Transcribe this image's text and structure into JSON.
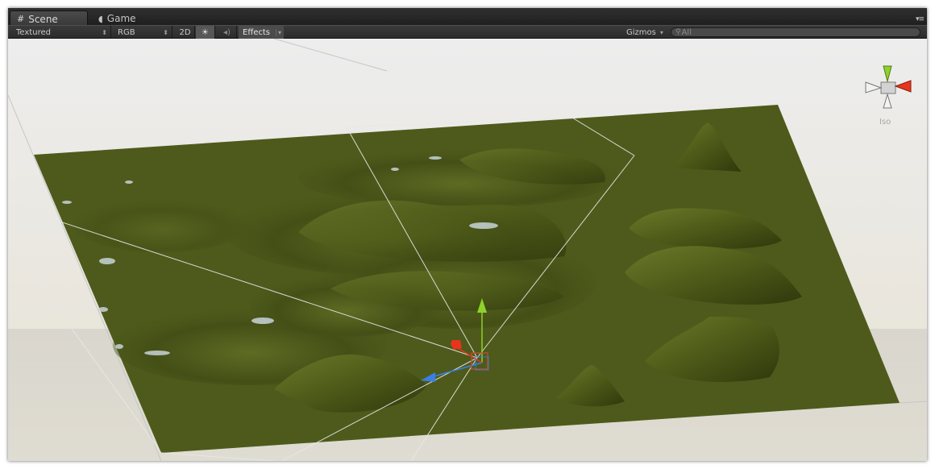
{
  "tabs": [
    {
      "label": "Scene",
      "icon": "grid-icon",
      "active": true
    },
    {
      "label": "Game",
      "icon": "pacman-icon",
      "active": false
    }
  ],
  "toolbar": {
    "render_mode": "Textured",
    "color_mode": "RGB",
    "mode_2d": "2D",
    "lighting_icon": "sun-icon",
    "audio_icon": "speaker-icon",
    "effects_label": "Effects",
    "gizmos_label": "Gizmos",
    "search_placeholder": "All"
  },
  "orientation_gizmo": {
    "projection_label": "Iso",
    "axis_colors": {
      "x": "#e8341c",
      "y": "#8ed12b",
      "z": "#3a7fe8"
    }
  },
  "colors": {
    "terrain": "#4e5a1b",
    "sky_top": "#ececec",
    "sky_bottom": "#e6e1d4"
  }
}
